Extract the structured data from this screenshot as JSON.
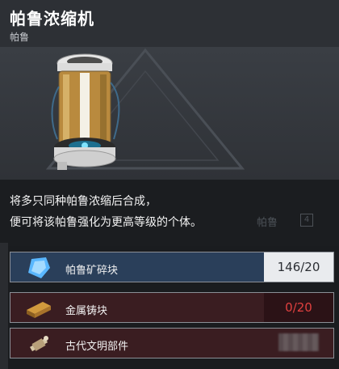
{
  "header": {
    "title": "帕鲁浓缩机",
    "subtitle": "帕鲁"
  },
  "description": {
    "line1": "将多只同种帕鲁浓缩后合成，",
    "line2": "便可将该帕鲁强化为更高等级的个体。"
  },
  "background_hint": {
    "label": "帕鲁",
    "badge": "4"
  },
  "materials": [
    {
      "name": "帕鲁矿碎块",
      "quantity": "146/20",
      "status": "sufficient",
      "icon": "pal-fluid-crystal-icon"
    },
    {
      "name": "金属铸块",
      "quantity": "0/20",
      "status": "insufficient",
      "icon": "ingot-icon"
    },
    {
      "name": "古代文明部件",
      "quantity": "",
      "status": "insufficient",
      "icon": "ancient-part-icon"
    }
  ],
  "colors": {
    "sufficient_row": "#2a3f5a",
    "insufficient_row": "#3a1d21",
    "insufficient_text": "#e0403f",
    "header_bg": "#2d3035"
  }
}
